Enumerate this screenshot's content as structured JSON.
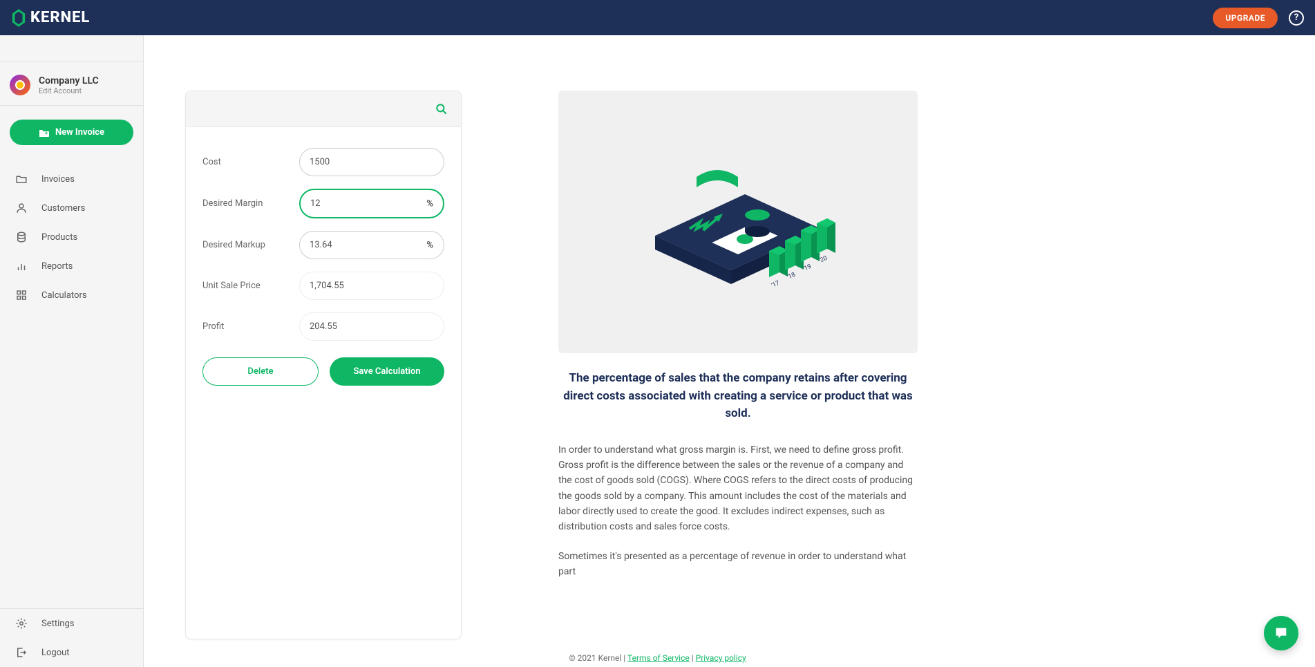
{
  "brand": "KERNEL",
  "header": {
    "upgrade": "UPGRADE"
  },
  "account": {
    "company": "Company LLC",
    "edit": "Edit Account"
  },
  "newInvoice": "New Invoice",
  "nav": {
    "invoices": "Invoices",
    "customers": "Customers",
    "products": "Products",
    "reports": "Reports",
    "calculators": "Calculators",
    "settings": "Settings",
    "logout": "Logout"
  },
  "calc": {
    "cost_label": "Cost",
    "cost_value": "1500",
    "margin_label": "Desired Margin",
    "margin_value": "12",
    "markup_label": "Desired Markup",
    "markup_value": "13.64",
    "unitprice_label": "Unit Sale Price",
    "unitprice_value": "1,704.55",
    "profit_label": "Profit",
    "profit_value": "204.55",
    "pct": "%",
    "delete": "Delete",
    "save": "Save Calculation"
  },
  "info": {
    "title": "The percentage of sales that the company retains after covering direct costs associated with creating a service or product that was sold.",
    "p1": "In order to understand what gross margin is. First, we need to define gross profit. Gross profit is the difference between the sales or the revenue of a company and the cost of goods sold (COGS). Where COGS refers to the direct costs of producing the goods sold by a company. This amount includes the cost of the materials and labor directly used to create the good. It excludes indirect expenses, such as distribution costs and sales force costs.",
    "p2": "Sometimes it's presented as a percentage of revenue in order to understand what part"
  },
  "footer": {
    "copyright": "© 2021 Kernel | ",
    "tos": "Terms of Service",
    "sep": " | ",
    "privacy": "Privacy policy"
  }
}
